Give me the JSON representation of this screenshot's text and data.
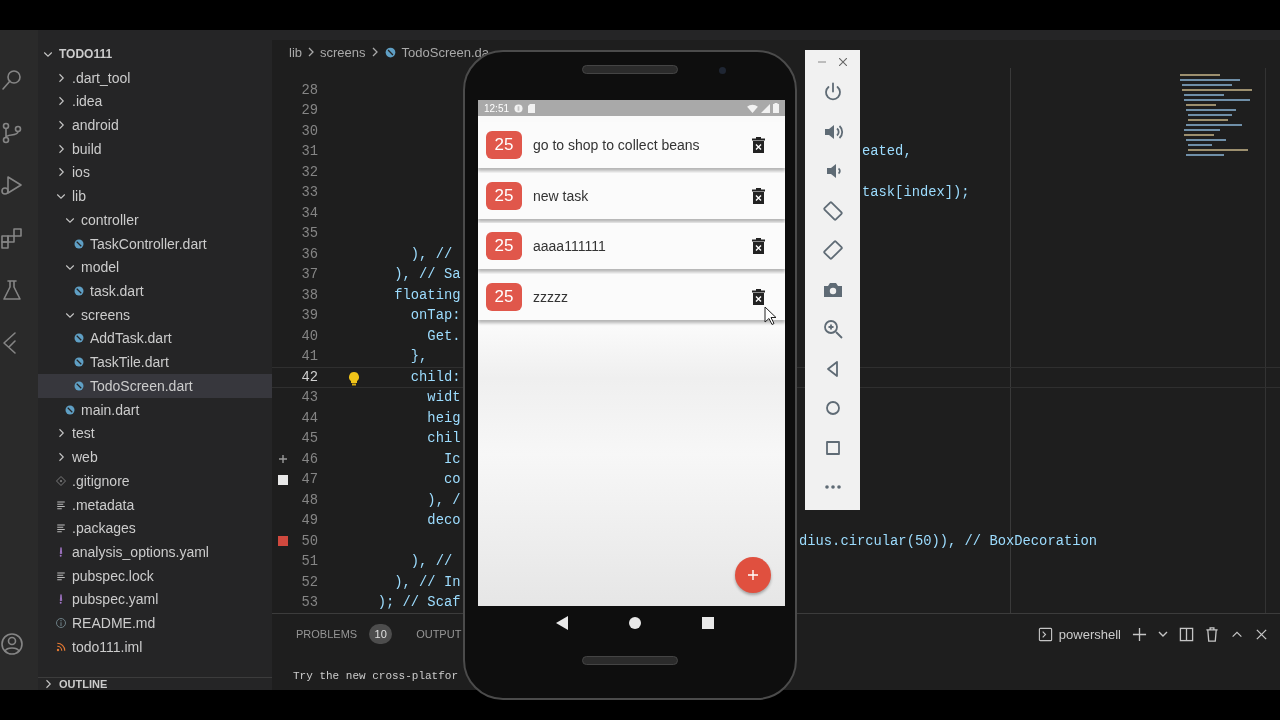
{
  "activity_bar": {
    "items": [
      {
        "kind": "search"
      },
      {
        "kind": "source-control"
      },
      {
        "kind": "run"
      },
      {
        "kind": "extensions"
      },
      {
        "kind": "testing"
      },
      {
        "kind": "flutter"
      },
      {
        "kind": "account"
      }
    ]
  },
  "explorer": {
    "root": {
      "label": "TODO111",
      "expanded": true
    },
    "items": [
      {
        "label": ".dart_tool",
        "kind": "folder",
        "expanded": false,
        "selected": false
      },
      {
        "label": ".idea",
        "kind": "folder",
        "expanded": false,
        "selected": false
      },
      {
        "label": "android",
        "kind": "folder",
        "expanded": false,
        "selected": false
      },
      {
        "label": "build",
        "kind": "folder",
        "expanded": false,
        "selected": false
      },
      {
        "label": "ios",
        "kind": "folder",
        "expanded": false,
        "selected": false
      },
      {
        "label": "lib",
        "kind": "folder",
        "expanded": true,
        "selected": false,
        "children": [
          {
            "label": "controller",
            "kind": "folder",
            "expanded": true,
            "selected": false,
            "children": [
              {
                "label": "TaskController.dart",
                "kind": "dart",
                "selected": false
              }
            ]
          },
          {
            "label": "model",
            "kind": "folder",
            "expanded": true,
            "selected": false,
            "children": [
              {
                "label": "task.dart",
                "kind": "dart",
                "selected": false
              }
            ]
          },
          {
            "label": "screens",
            "kind": "folder",
            "expanded": true,
            "selected": false,
            "children": [
              {
                "label": "AddTask.dart",
                "kind": "dart",
                "selected": false
              },
              {
                "label": "TaskTile.dart",
                "kind": "dart",
                "selected": false
              },
              {
                "label": "TodoScreen.dart",
                "kind": "dart",
                "selected": true
              }
            ]
          },
          {
            "label": "main.dart",
            "kind": "dart",
            "selected": false
          }
        ]
      },
      {
        "label": "test",
        "kind": "folder",
        "expanded": false,
        "selected": false
      },
      {
        "label": "web",
        "kind": "folder",
        "expanded": false,
        "selected": false
      },
      {
        "label": ".gitignore",
        "kind": "git",
        "selected": false
      },
      {
        "label": ".metadata",
        "kind": "text",
        "selected": false
      },
      {
        "label": ".packages",
        "kind": "text",
        "selected": false
      },
      {
        "label": "analysis_options.yaml",
        "kind": "yaml",
        "selected": false
      },
      {
        "label": "pubspec.lock",
        "kind": "text",
        "selected": false
      },
      {
        "label": "pubspec.yaml",
        "kind": "yaml",
        "selected": false
      },
      {
        "label": "README.md",
        "kind": "info",
        "selected": false
      },
      {
        "label": "todo111.iml",
        "kind": "feed",
        "selected": false
      }
    ],
    "outline": {
      "label": "OUTLINE",
      "expanded": false
    }
  },
  "breadcrumbs": [
    {
      "label": "lib"
    },
    {
      "label": "screens"
    },
    {
      "label": "TodoScreen.da",
      "kind": "dart"
    }
  ],
  "editor": {
    "lines": [
      {
        "number": "28",
        "current": false
      },
      {
        "number": "29",
        "current": false
      },
      {
        "number": "30",
        "current": false
      },
      {
        "number": "31",
        "current": false,
        "tail": {
          "text": "eated,",
          "kind": "beside-toolbar"
        }
      },
      {
        "number": "32",
        "current": false
      },
      {
        "number": "33",
        "current": false,
        "tail": {
          "text": "task[index]);",
          "kind": "beside-toolbar"
        }
      },
      {
        "number": "34",
        "current": false
      },
      {
        "number": "35",
        "current": false
      },
      {
        "number": "36",
        "current": false,
        "code": "          ), //"
      },
      {
        "number": "37",
        "current": false,
        "code": "        ), // Sa"
      },
      {
        "number": "38",
        "current": false,
        "code": "        floating"
      },
      {
        "number": "39",
        "current": false,
        "code": "          onTap:"
      },
      {
        "number": "40",
        "current": false,
        "code": "            Get."
      },
      {
        "number": "41",
        "current": false,
        "code": "          },"
      },
      {
        "number": "42",
        "current": true,
        "glyph": {
          "kind": "lightbulb"
        },
        "code": "          child:"
      },
      {
        "number": "43",
        "current": false,
        "code": "            widt"
      },
      {
        "number": "44",
        "current": false,
        "code": "            heig"
      },
      {
        "number": "45",
        "current": false,
        "code": "            chil"
      },
      {
        "number": "46",
        "current": false,
        "marker": {
          "kind": "added"
        },
        "code": "              Ic"
      },
      {
        "number": "47",
        "current": false,
        "marker": {
          "kind": "modified"
        },
        "code": "              co"
      },
      {
        "number": "48",
        "current": false,
        "code": "            ), /"
      },
      {
        "number": "49",
        "current": false,
        "code": "            deco"
      },
      {
        "number": "50",
        "current": false,
        "marker": {
          "kind": "error"
        },
        "tail": {
          "text": "dius.circular(50)), // BoxDecoration",
          "kind": "beside-phone"
        }
      },
      {
        "number": "51",
        "current": false,
        "code": "          ), //"
      },
      {
        "number": "52",
        "current": false,
        "code": "        ), // In"
      },
      {
        "number": "53",
        "current": false,
        "code": "      ); // Scaf"
      }
    ]
  },
  "panel": {
    "tabs": [
      {
        "label": "PROBLEMS",
        "badge": "10"
      },
      {
        "label": "OUTPUT"
      }
    ],
    "terminal": {
      "name": "powershell",
      "lines": [
        "Try the new cross-platfor"
      ]
    }
  },
  "phone": {
    "status_bar": {
      "time": "12:51"
    },
    "tasks": [
      {
        "date": "25",
        "title": "go to shop to collect beans"
      },
      {
        "date": "25",
        "title": "new task"
      },
      {
        "date": "25",
        "title": "aaaa111111"
      },
      {
        "date": "25",
        "title": "zzzzz"
      }
    ]
  },
  "emulator_toolbar": {
    "buttons": [
      {
        "kind": "power"
      },
      {
        "kind": "volume-up"
      },
      {
        "kind": "volume-down"
      },
      {
        "kind": "rotate-left"
      },
      {
        "kind": "rotate-right"
      },
      {
        "kind": "camera"
      },
      {
        "kind": "zoom"
      },
      {
        "kind": "back"
      },
      {
        "kind": "home"
      },
      {
        "kind": "overview"
      },
      {
        "kind": "more"
      }
    ]
  }
}
